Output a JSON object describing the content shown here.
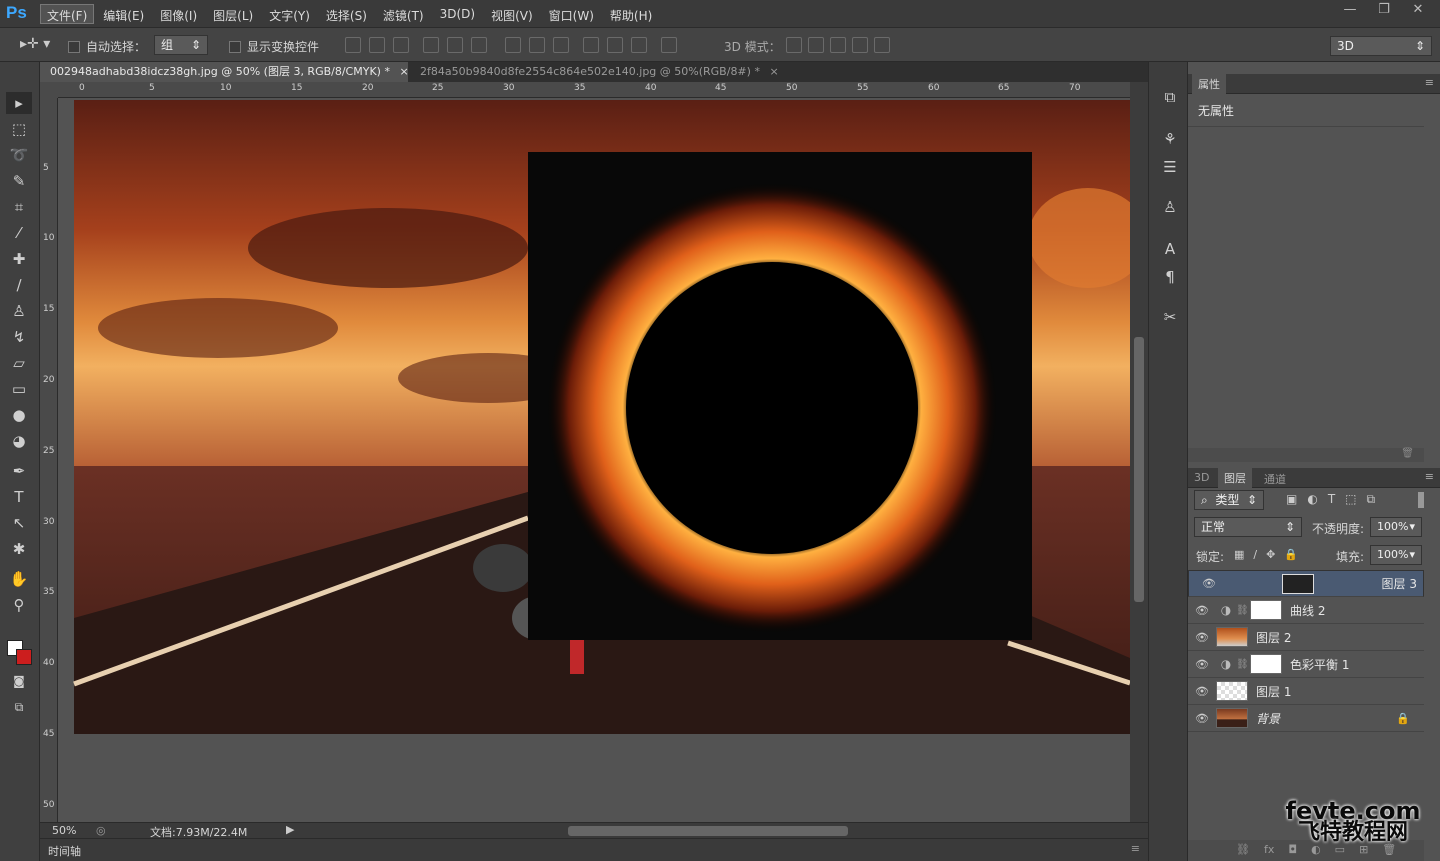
{
  "app": {
    "logo": "Ps"
  },
  "menu": [
    "文件(F)",
    "编辑(E)",
    "图像(I)",
    "图层(L)",
    "文字(Y)",
    "选择(S)",
    "滤镜(T)",
    "3D(D)",
    "视图(V)",
    "窗口(W)",
    "帮助(H)"
  ],
  "options": {
    "auto_select_label": "自动选择：",
    "auto_select_value": "组",
    "show_transform_label": "显示变换控件",
    "mode_3d_label": "3D 模式：",
    "workspace_value": "3D"
  },
  "tabs": [
    {
      "label": "002948adhabd38idcz38gh.jpg @ 50% (图层 3, RGB/8/CMYK) *",
      "close": "×"
    },
    {
      "label": "2f84a50b9840d8fe2554c864e502e140.jpg @ 50%(RGB/8#) *",
      "close": "×"
    }
  ],
  "ruler_h": [
    "0",
    "5",
    "10",
    "15",
    "20",
    "25",
    "30",
    "35",
    "40",
    "45",
    "50",
    "55",
    "60",
    "65",
    "70"
  ],
  "ruler_v": [
    "5",
    "10",
    "15",
    "20",
    "25",
    "30",
    "35",
    "40",
    "45",
    "50"
  ],
  "status": {
    "zoom": "50%",
    "doc": "文档:7.93M/22.4M"
  },
  "timeline_label": "时间轴",
  "properties": {
    "tab": "属性",
    "content": "无属性"
  },
  "layers_panel": {
    "tabs": [
      "3D",
      "图层",
      "通道"
    ],
    "filter_label": "类型",
    "blend_mode": "正常",
    "opacity_label": "不透明度:",
    "opacity_value": "100%",
    "lock_label": "锁定:",
    "fill_label": "填充:",
    "fill_value": "100%",
    "layers": [
      {
        "name": "图层 3",
        "selected": true
      },
      {
        "name": "曲线 2",
        "adjustment": true
      },
      {
        "name": "图层 2"
      },
      {
        "name": "色彩平衡 1",
        "adjustment": true
      },
      {
        "name": "图层 1"
      },
      {
        "name": "背景",
        "locked": true
      }
    ]
  },
  "watermark": {
    "line1": "fevte.com",
    "line2": "飞特教程网"
  },
  "colors": {
    "ps_blue": "#3da8ff",
    "selected_layer": "#4a5a72",
    "foreground": "#ffffff",
    "background": "#cc1e1e"
  }
}
